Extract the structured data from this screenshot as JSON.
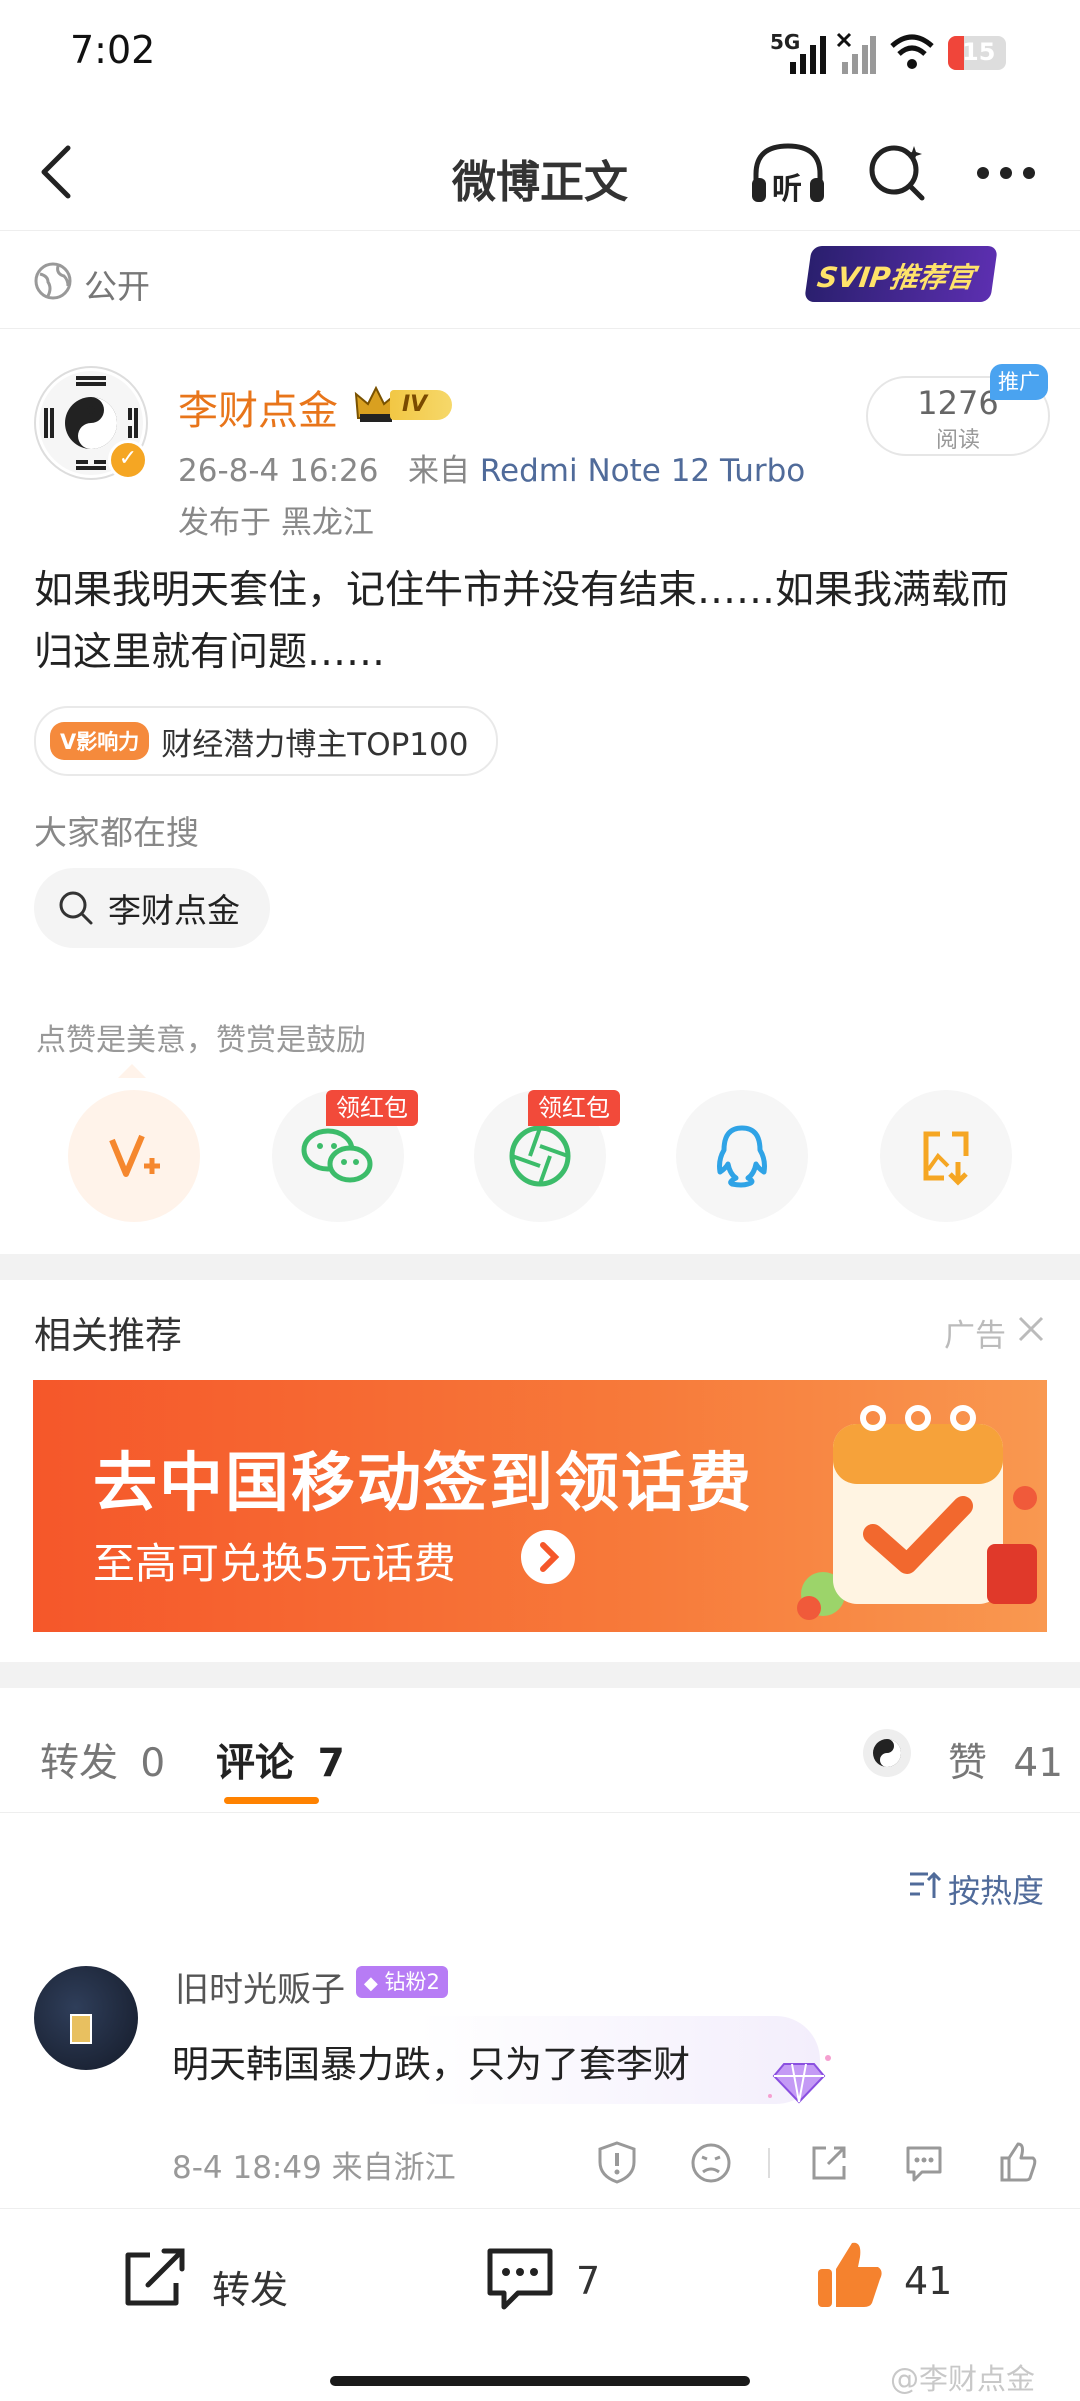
{
  "status_bar": {
    "time": "7:02",
    "network": "5G",
    "battery": "15"
  },
  "nav": {
    "title": "微博正文",
    "listen_label": "听"
  },
  "visibility": {
    "label": "公开",
    "badge": "SVIP推荐官"
  },
  "post": {
    "author": "李财点金",
    "level_badge": "IV",
    "date": "26-8-4 16:26",
    "source_prefix": "来自",
    "device": "Redmi Note 12 Turbo",
    "location": "发布于 黑龙江",
    "read_count": "1276",
    "read_label": "阅读",
    "promo_tag": "推广",
    "text": "如果我明天套住，记住牛市并没有结束……如果我满载而归这里就有问题……",
    "influence_badge": "V影响力",
    "influence_text": "财经潜力博主TOP100"
  },
  "search": {
    "title": "大家都在搜",
    "chip": "李财点金"
  },
  "reward": {
    "text": "点赞是美意，赞赏是鼓励",
    "red_packet_label_1": "领红包",
    "red_packet_label_2": "领红包"
  },
  "related": {
    "title": "相关推荐",
    "ad_label": "广告"
  },
  "banner": {
    "headline": "去中国移动签到领话费",
    "subline": "至高可兑换5元话费"
  },
  "tabs": {
    "repost_label": "转发",
    "repost_count": "0",
    "comment_label": "评论",
    "comment_count": "7",
    "like_label": "赞",
    "like_count": "41"
  },
  "sort": {
    "label": "按热度"
  },
  "comment": {
    "user": "旧时光贩子",
    "badge": "钻粉2",
    "text": "明天韩国暴力跌，只为了套李财",
    "meta": "8-4 18:49  来自浙江"
  },
  "bottom_bar": {
    "repost_label": "转发",
    "comment_count": "7",
    "like_count": "41"
  },
  "watermark": "@李财点金",
  "colors": {
    "accent": "#ff8200",
    "name": "#e8751a",
    "link": "#506b9a"
  }
}
